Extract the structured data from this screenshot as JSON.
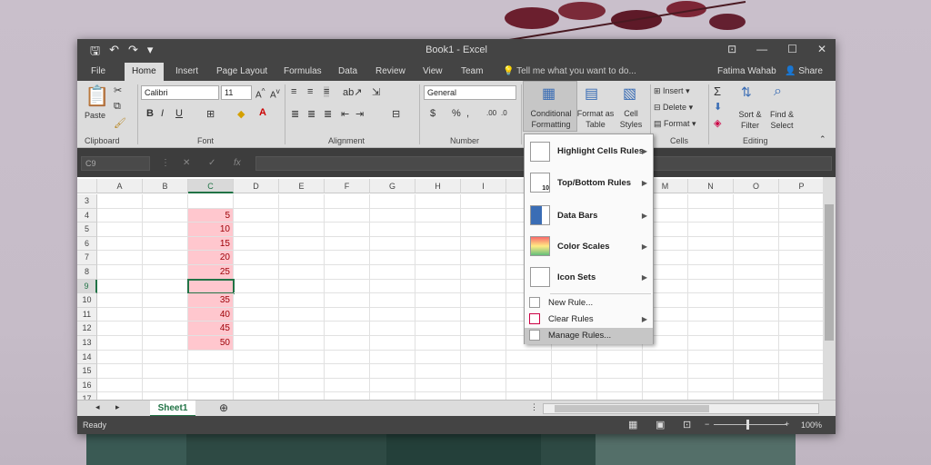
{
  "window": {
    "title": "Book1 - Excel",
    "user": "Fatima Wahab",
    "share": "Share"
  },
  "tabs": [
    "File",
    "Home",
    "Insert",
    "Page Layout",
    "Formulas",
    "Data",
    "Review",
    "View",
    "Team"
  ],
  "tell_me": "Tell me what you want to do...",
  "ribbon": {
    "clipboard": {
      "paste": "Paste",
      "label": "Clipboard"
    },
    "font": {
      "name": "Calibri",
      "size": "11",
      "label": "Font"
    },
    "alignment": {
      "label": "Alignment"
    },
    "number": {
      "format": "General",
      "label": "Number"
    },
    "styles": {
      "cond_fmt_1": "Conditional",
      "cond_fmt_2": "Formatting",
      "fmt_table_1": "Format as",
      "fmt_table_2": "Table",
      "cell_styles_1": "Cell",
      "cell_styles_2": "Styles"
    },
    "cells": {
      "insert": "Insert",
      "delete": "Delete",
      "format": "Format",
      "label": "Cells"
    },
    "editing": {
      "sort_1": "Sort &",
      "sort_2": "Filter",
      "find_1": "Find &",
      "find_2": "Select",
      "label": "Editing"
    }
  },
  "formula_bar": {
    "name_box": "C9",
    "fx": "fx"
  },
  "columns": [
    "A",
    "B",
    "C",
    "D",
    "E",
    "F",
    "G",
    "H",
    "I",
    "J",
    "K",
    "L",
    "M",
    "N",
    "O",
    "P"
  ],
  "rows": [
    "3",
    "4",
    "5",
    "6",
    "7",
    "8",
    "9",
    "10",
    "11",
    "12",
    "13",
    "14",
    "15",
    "16",
    "17"
  ],
  "column_c_values": [
    "",
    "5",
    "10",
    "15",
    "20",
    "25",
    "",
    "35",
    "40",
    "45",
    "50",
    "",
    "",
    "",
    ""
  ],
  "sheet": {
    "name": "Sheet1"
  },
  "status": {
    "ready": "Ready",
    "zoom": "100%"
  },
  "menu": {
    "items": [
      {
        "label": "Highlight Cells Rules"
      },
      {
        "label": "Top/Bottom Rules"
      },
      {
        "label": "Data Bars"
      },
      {
        "label": "Color Scales"
      },
      {
        "label": "Icon Sets"
      },
      {
        "label": "New Rule..."
      },
      {
        "label": "Clear Rules"
      },
      {
        "label": "Manage Rules..."
      }
    ],
    "topbottom_badge": "10"
  },
  "colors": {
    "accent": "#217346",
    "pink_fill": "#ffc7ce",
    "pink_text": "#9c0006",
    "chrome": "#444444"
  }
}
